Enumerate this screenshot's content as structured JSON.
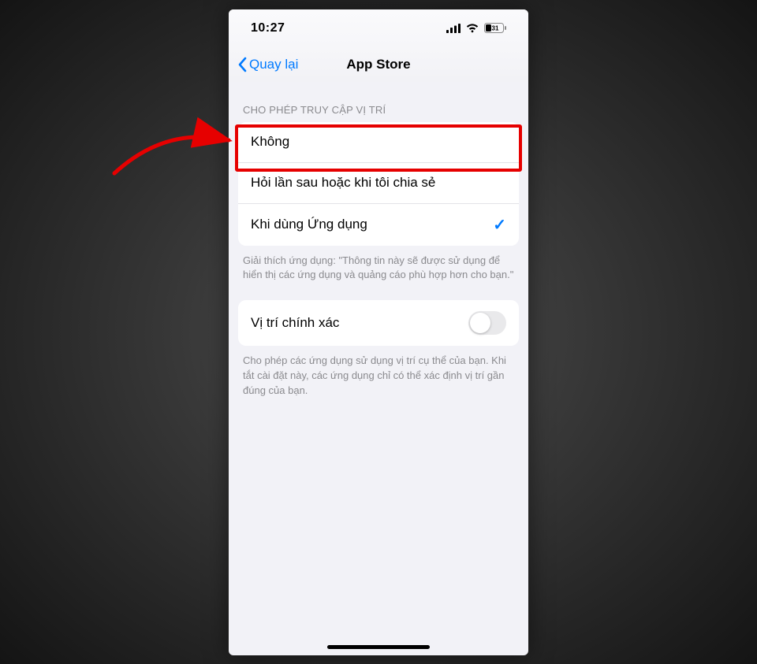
{
  "status": {
    "time": "10:27",
    "battery_pct": "31"
  },
  "nav": {
    "back_label": "Quay lại",
    "title": "App Store"
  },
  "location_section": {
    "header": "CHO PHÉP TRUY CẬP VỊ TRÍ",
    "options": [
      {
        "label": "Không",
        "selected": false
      },
      {
        "label": "Hỏi lần sau hoặc khi tôi chia sẻ",
        "selected": false
      },
      {
        "label": "Khi dùng Ứng dụng",
        "selected": true
      }
    ],
    "footer": "Giải thích ứng dụng: \"Thông tin này sẽ được sử dụng để hiển thị các ứng dụng và quảng cáo phù hợp hơn cho bạn.\""
  },
  "precise_section": {
    "label": "Vị trí chính xác",
    "enabled": false,
    "footer": "Cho phép các ứng dụng sử dụng vị trí cụ thể của bạn. Khi tắt cài đặt này, các ứng dụng chỉ có thể xác định vị trí gần đúng của bạn."
  },
  "annotation": {
    "highlight_color": "#e60000",
    "arrow_color": "#e60000"
  }
}
